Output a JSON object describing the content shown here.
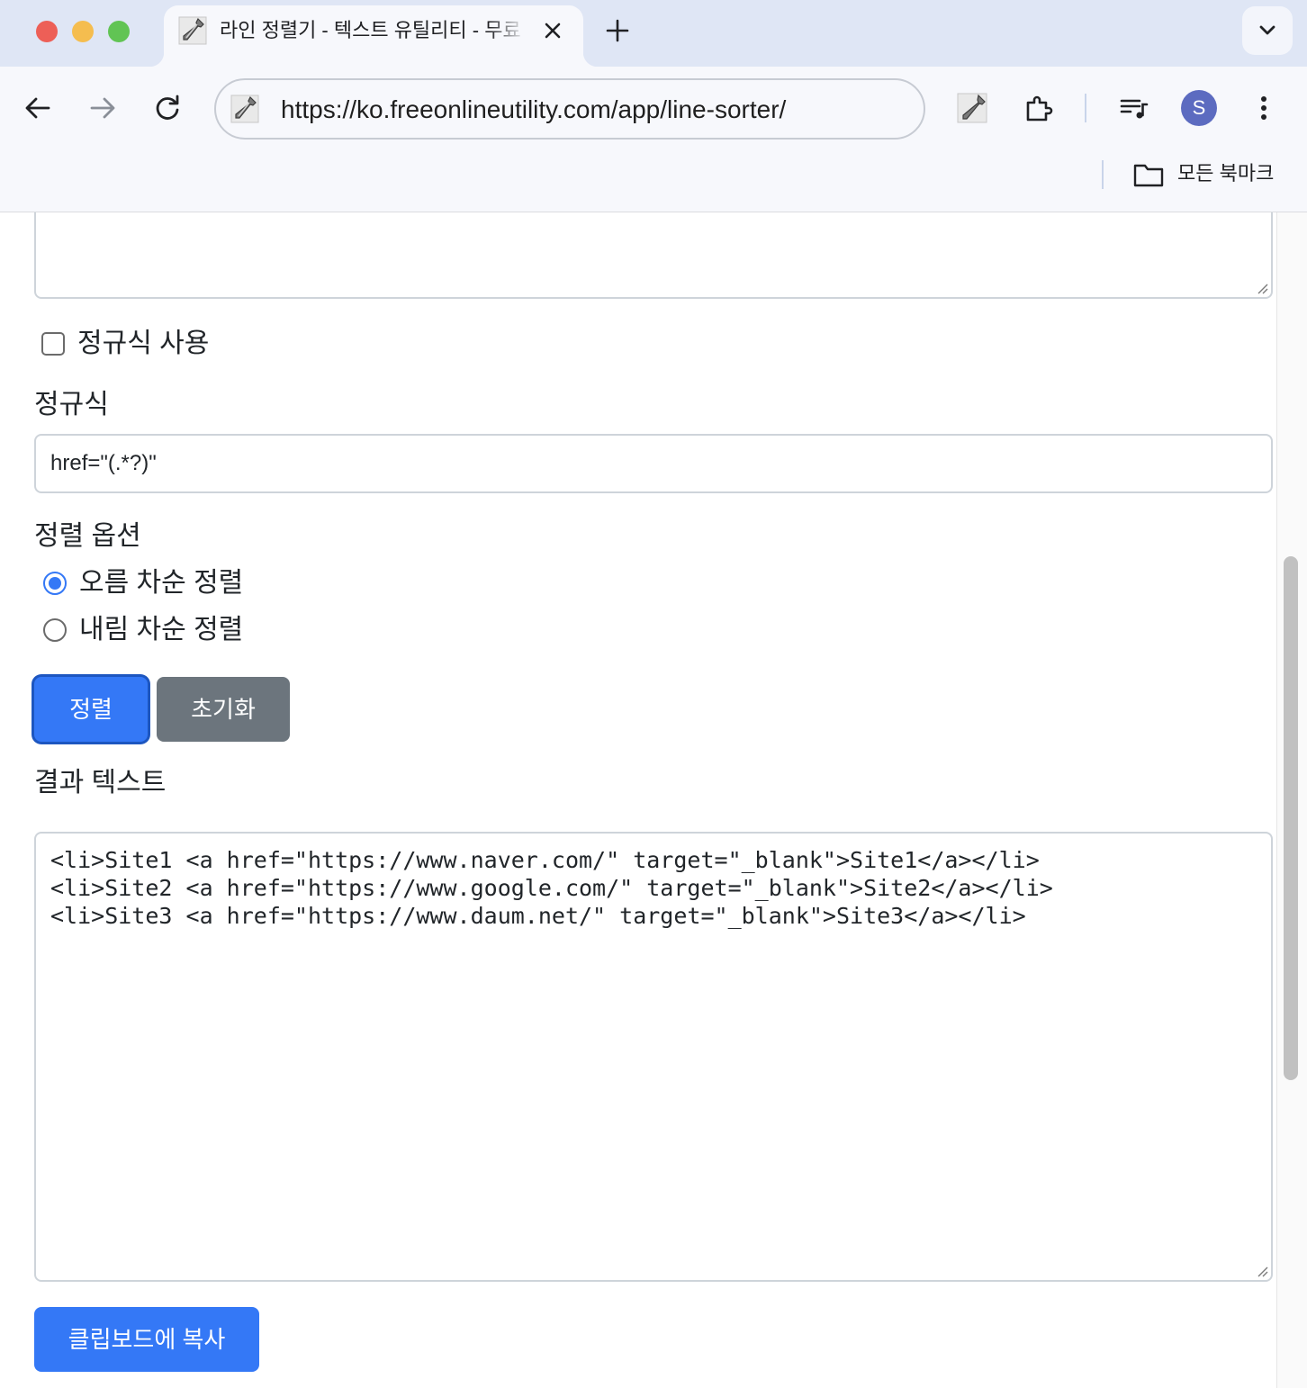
{
  "browser": {
    "tab_title": "라인 정렬기 - 텍스트 유틸리티 - 무료 온라인 유틸리티",
    "url": "https://ko.freeonlineutility.com/app/line-sorter/",
    "profile_initial": "S",
    "bookmarks_label": "모든 북마크",
    "traffic_colors": [
      "#ed5f57",
      "#f5bd4f",
      "#61c454"
    ]
  },
  "page": {
    "regex_checkbox_label": "정규식 사용",
    "regex_checked": false,
    "regex_label": "정규식",
    "regex_value": "href=\"(.*?)\"",
    "sort_options_label": "정렬 옵션",
    "sort_options": [
      {
        "label": "오름 차순 정렬",
        "selected": true
      },
      {
        "label": "내림 차순 정렬",
        "selected": false
      }
    ],
    "sort_button": "정렬",
    "reset_button": "초기화",
    "result_label": "결과 텍스트",
    "result_lines": [
      "<li>Site1 <a href=\"https://www.naver.com/\" target=\"_blank\">Site1</a></li>",
      "<li>Site2 <a href=\"https://www.google.com/\" target=\"_blank\">Site2</a></li>",
      "<li>Site3 <a href=\"https://www.daum.net/\" target=\"_blank\">Site3</a></li>"
    ],
    "copy_button": "클립보드에 복사"
  },
  "colors": {
    "primary": "#3478f6",
    "secondary": "#6c757d",
    "tabstrip": "#dfe6f5",
    "avatar": "#5c6bc0"
  }
}
